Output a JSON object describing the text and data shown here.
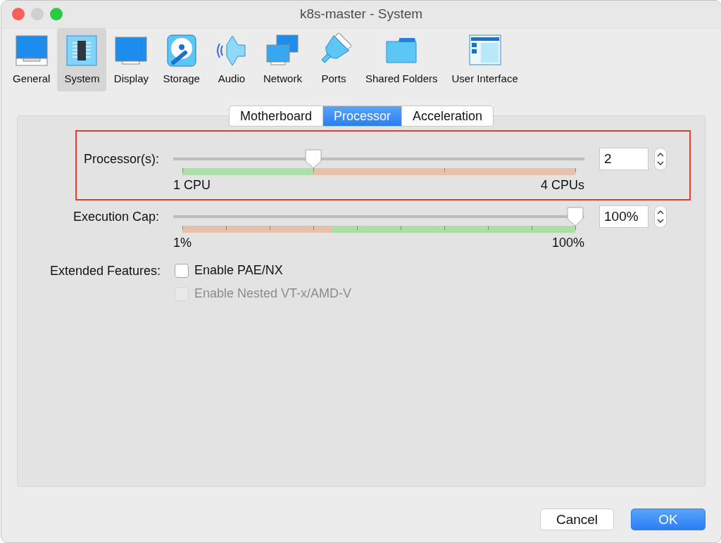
{
  "window": {
    "title": "k8s-master - System"
  },
  "toolbar": [
    {
      "label": "General",
      "selected": false
    },
    {
      "label": "System",
      "selected": true
    },
    {
      "label": "Display",
      "selected": false
    },
    {
      "label": "Storage",
      "selected": false
    },
    {
      "label": "Audio",
      "selected": false
    },
    {
      "label": "Network",
      "selected": false
    },
    {
      "label": "Ports",
      "selected": false
    },
    {
      "label": "Shared Folders",
      "selected": false
    },
    {
      "label": "User Interface",
      "selected": false
    }
  ],
  "tabs": [
    {
      "label": "Motherboard",
      "selected": false
    },
    {
      "label": "Processor",
      "selected": true
    },
    {
      "label": "Acceleration",
      "selected": false
    }
  ],
  "sliders": [
    {
      "kind": "cpu",
      "label": "Processor(s):",
      "level": 0.333,
      "min_label": "1 CPU",
      "max_label": "4 CPUs",
      "value": "2",
      "highlighted": true
    },
    {
      "kind": "cap",
      "label": "Execution Cap:",
      "level": 1,
      "min_label": "1%",
      "max_label": "100%",
      "value": "100%",
      "highlighted": false
    }
  ],
  "extended_features": {
    "label": "Extended Features:",
    "options": [
      {
        "label": "Enable PAE/NX",
        "checked": false,
        "disabled": false
      },
      {
        "label": "Enable Nested VT-x/AMD-V",
        "checked": false,
        "disabled": true
      }
    ]
  },
  "buttons": [
    {
      "label": "Cancel",
      "kind": "secondary"
    },
    {
      "label": "OK",
      "kind": "primary"
    }
  ]
}
